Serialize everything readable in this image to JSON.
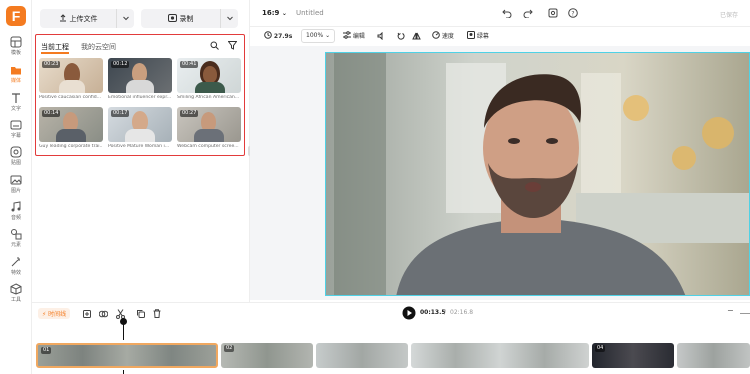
{
  "app": {
    "logo_letter": "F"
  },
  "rail": [
    {
      "label": "模板",
      "icon": "template-icon"
    },
    {
      "label": "媒体",
      "icon": "folder-icon",
      "active": true
    },
    {
      "label": "文字",
      "icon": "text-icon"
    },
    {
      "label": "字幕",
      "icon": "subtitle-icon"
    },
    {
      "label": "贴图",
      "icon": "sticker-icon"
    },
    {
      "label": "图片",
      "icon": "image-icon"
    },
    {
      "label": "音频",
      "icon": "music-icon"
    },
    {
      "label": "元素",
      "icon": "shapes-icon"
    },
    {
      "label": "特效",
      "icon": "effects-icon"
    },
    {
      "label": "工具",
      "icon": "toolbox-icon"
    }
  ],
  "panel": {
    "upload_label": "上传文件",
    "record_label": "录制",
    "tabs": [
      "当前工程",
      "我的云空间"
    ],
    "thumbs": [
      {
        "duration": "00:23",
        "caption": "Positive caucasian confid..."
      },
      {
        "duration": "00:12",
        "caption": "Emotional influencer expr..."
      },
      {
        "duration": "00:41",
        "caption": "Smiling African American..."
      },
      {
        "duration": "00:14",
        "caption": "Guy leading corporate trai..."
      },
      {
        "duration": "00:17",
        "caption": "Positive Mature Woman i..."
      },
      {
        "duration": "00:27",
        "caption": "Webcam computer scree..."
      }
    ]
  },
  "topbar": {
    "ratio": "16:9",
    "project_title": "Untitled",
    "save_label": "已保存"
  },
  "toolbar": {
    "duration": "27.9s",
    "zoom": "100%",
    "edit_label": "编辑",
    "speed_label": "速度",
    "crop_label": "绿幕"
  },
  "timeline": {
    "tag_label": "时间线",
    "current_time": "00:13.5",
    "total_time": "02:16.8",
    "clips": [
      {
        "badge": "01"
      },
      {
        "badge": "02"
      },
      {
        "badge": ""
      },
      {
        "badge": ""
      },
      {
        "badge": "04"
      },
      {
        "badge": ""
      }
    ]
  },
  "colors": {
    "accent": "#f47b20",
    "selection_red": "#e23b3b",
    "preview_border": "#4fd2e6"
  }
}
